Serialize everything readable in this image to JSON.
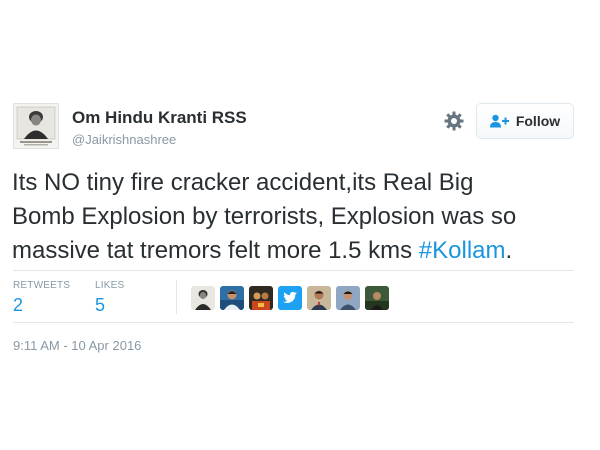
{
  "user": {
    "display_name": "Om Hindu Kranti RSS",
    "screen_name": "@Jaikrishnashree",
    "avatar_icon": "portrait-avatar-icon"
  },
  "actions": {
    "follow_label": "Follow",
    "settings_icon": "gear-icon",
    "follow_icon": "add-user-icon"
  },
  "tweet": {
    "lines": [
      "Its NO tiny fire cracker accident,its Real Big",
      "Bomb Explosion by terrorists, Explosion was so",
      "massive tat tremors felt more 1.5 kms "
    ],
    "hashtag": "#Kollam",
    "trailing": "."
  },
  "stats": {
    "retweets_label": "RETWEETS",
    "retweets_count": "2",
    "likes_label": "LIKES",
    "likes_count": "5"
  },
  "likers": [
    {
      "icon": "portrait-avatar-icon"
    },
    {
      "icon": "person-avatar-icon"
    },
    {
      "icon": "group-avatar-icon"
    },
    {
      "icon": "twitter-bird-icon"
    },
    {
      "icon": "person-suit-avatar-icon"
    },
    {
      "icon": "person-avatar-icon"
    },
    {
      "icon": "outdoor-avatar-icon"
    }
  ],
  "timestamp": "9:11 AM - 10 Apr 2016",
  "colors": {
    "link": "#1b95e0",
    "muted": "#8899a6",
    "text": "#292f33",
    "border": "#e1e8ed"
  }
}
